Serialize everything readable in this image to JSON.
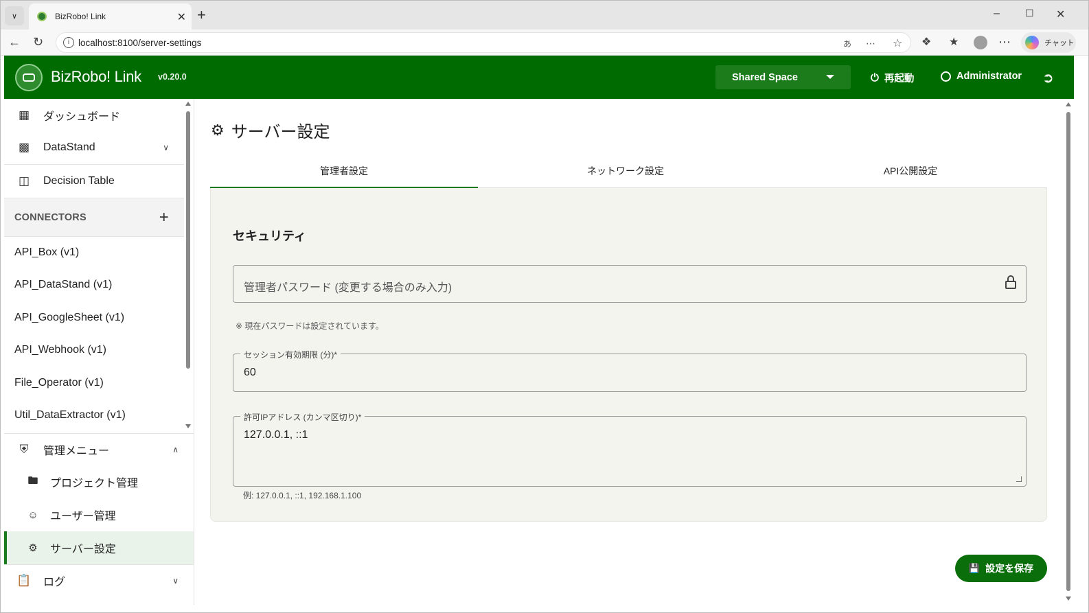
{
  "browser": {
    "tab_title": "BizRobo! Link",
    "url": "localhost:8100/server-settings",
    "copilot_label": "チャット"
  },
  "app": {
    "name": "BizRobo! Link",
    "version": "v0.20.0",
    "space_selector": "Shared Space",
    "restart_label": "再起動",
    "user_label": "Administrator",
    "brand_color": "#006b00"
  },
  "sidebar": {
    "items": [
      {
        "label": "ダッシュボード",
        "icon": "dashboard-icon"
      },
      {
        "label": "DataStand",
        "icon": "bar-chart-icon"
      },
      {
        "label": "Decision Table",
        "icon": "table-icon"
      }
    ],
    "connectors_header": "CONNECTORS",
    "connectors": [
      "API_Box (v1)",
      "API_DataStand (v1)",
      "API_GoogleSheet (v1)",
      "API_Webhook (v1)",
      "File_Operator (v1)",
      "Util_DataExtractor (v1)"
    ],
    "admin_menu": {
      "label": "管理メニュー",
      "items": [
        {
          "label": "プロジェクト管理",
          "icon": "folder-icon"
        },
        {
          "label": "ユーザー管理",
          "icon": "users-icon"
        },
        {
          "label": "サーバー設定",
          "icon": "gear-icon",
          "active": true
        }
      ]
    },
    "log_label": "ログ"
  },
  "main": {
    "page_title": "サーバー設定",
    "tabs": [
      {
        "label": "管理者設定",
        "active": true
      },
      {
        "label": "ネットワーク設定"
      },
      {
        "label": "API公開設定"
      }
    ],
    "section_title": "セキュリティ",
    "password_placeholder": "管理者パスワード (変更する場合のみ入力)",
    "password_note": "※ 現在パスワードは設定されています。",
    "session_label": "セッション有効期限 (分)*",
    "session_value": "60",
    "ip_label": "許可IPアドレス (カンマ区切り)*",
    "ip_value": "127.0.0.1, ::1",
    "ip_helper": "例: 127.0.0.1, ::1, 192.168.1.100",
    "save_label": "設定を保存"
  }
}
